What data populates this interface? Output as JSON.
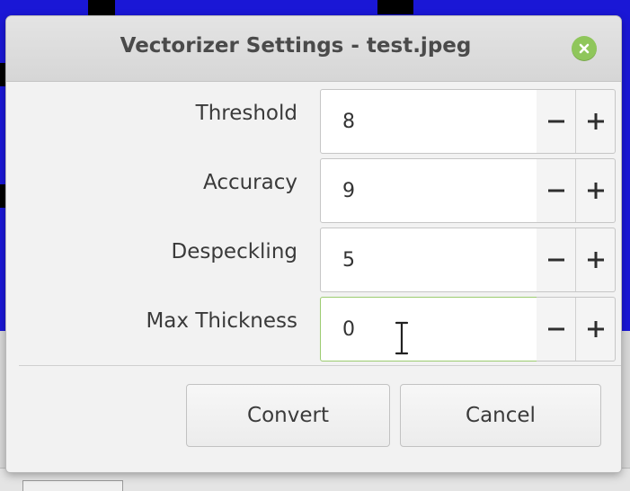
{
  "dialog": {
    "title": "Vectorizer Settings - test.jpeg",
    "close_icon": "close-icon",
    "accent_color": "#8fc65b"
  },
  "fields": [
    {
      "label": "Threshold",
      "value": "8"
    },
    {
      "label": "Accuracy",
      "value": "9"
    },
    {
      "label": "Despeckling",
      "value": "5"
    },
    {
      "label": "Max Thickness",
      "value": "0"
    }
  ],
  "stepper": {
    "minus_icon": "minus-icon",
    "plus_icon": "plus-icon"
  },
  "buttons": {
    "convert": "Convert",
    "cancel": "Cancel"
  },
  "cursor_icon": "text-cursor-icon"
}
